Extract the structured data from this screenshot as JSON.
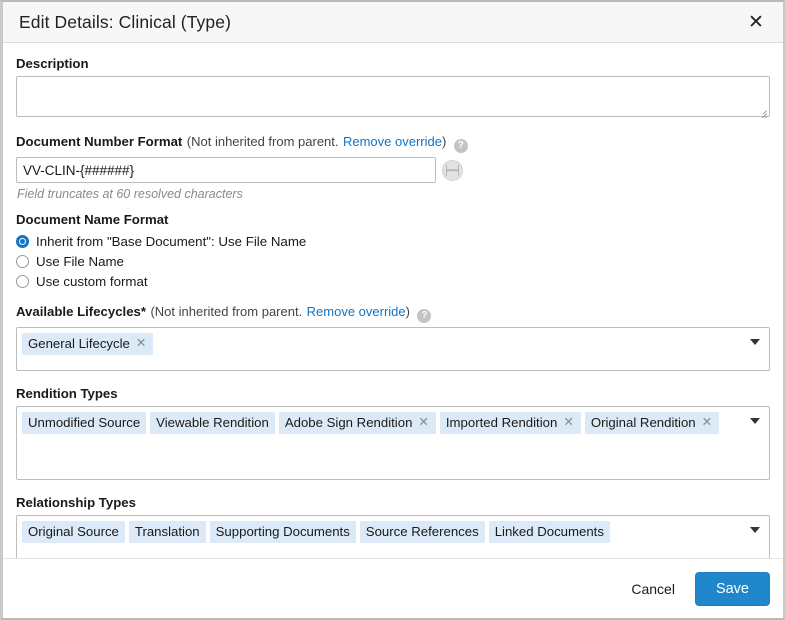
{
  "dialog": {
    "title": "Edit Details: Clinical (Type)",
    "close_label": "✕"
  },
  "description": {
    "label": "Description",
    "value": "",
    "placeholder": ""
  },
  "document_number_format": {
    "label": "Document Number Format",
    "inherit_note_prefix": "(Not inherited from parent.",
    "remove_override_link": "Remove override",
    "inherit_note_suffix": ")",
    "help_glyph": "?",
    "value": "VV-CLIN-{######}",
    "helper_text": "Field truncates at 60 resolved characters"
  },
  "document_name_format": {
    "label": "Document Name Format",
    "options": [
      {
        "label": "Inherit from \"Base Document\": Use File Name",
        "selected": true
      },
      {
        "label": "Use File Name",
        "selected": false
      },
      {
        "label": "Use custom format",
        "selected": false
      }
    ]
  },
  "available_lifecycles": {
    "label": "Available Lifecycles*",
    "inherit_note_prefix": "(Not inherited from parent.",
    "remove_override_link": "Remove override",
    "inherit_note_suffix": ")",
    "help_glyph": "?",
    "tags": [
      {
        "label": "General Lifecycle",
        "removable": true
      }
    ]
  },
  "rendition_types": {
    "label": "Rendition Types",
    "tags": [
      {
        "label": "Unmodified Source",
        "removable": false
      },
      {
        "label": "Viewable Rendition",
        "removable": false
      },
      {
        "label": "Adobe Sign Rendition",
        "removable": true
      },
      {
        "label": "Imported Rendition",
        "removable": true
      },
      {
        "label": "Original Rendition",
        "removable": true
      }
    ]
  },
  "relationship_types": {
    "label": "Relationship Types",
    "tags": [
      {
        "label": "Original Source",
        "removable": false
      },
      {
        "label": "Translation",
        "removable": false
      },
      {
        "label": "Supporting Documents",
        "removable": false
      },
      {
        "label": "Source References",
        "removable": false
      },
      {
        "label": "Linked Documents",
        "removable": false
      }
    ]
  },
  "footer": {
    "cancel_label": "Cancel",
    "save_label": "Save"
  },
  "colors": {
    "accent_blue": "#2087cd",
    "link_blue": "#1274c4",
    "tag_bg": "#dbeaf6",
    "titlebar_bg": "#f7f7f7"
  },
  "icons": {
    "remove_tag": "✕"
  }
}
